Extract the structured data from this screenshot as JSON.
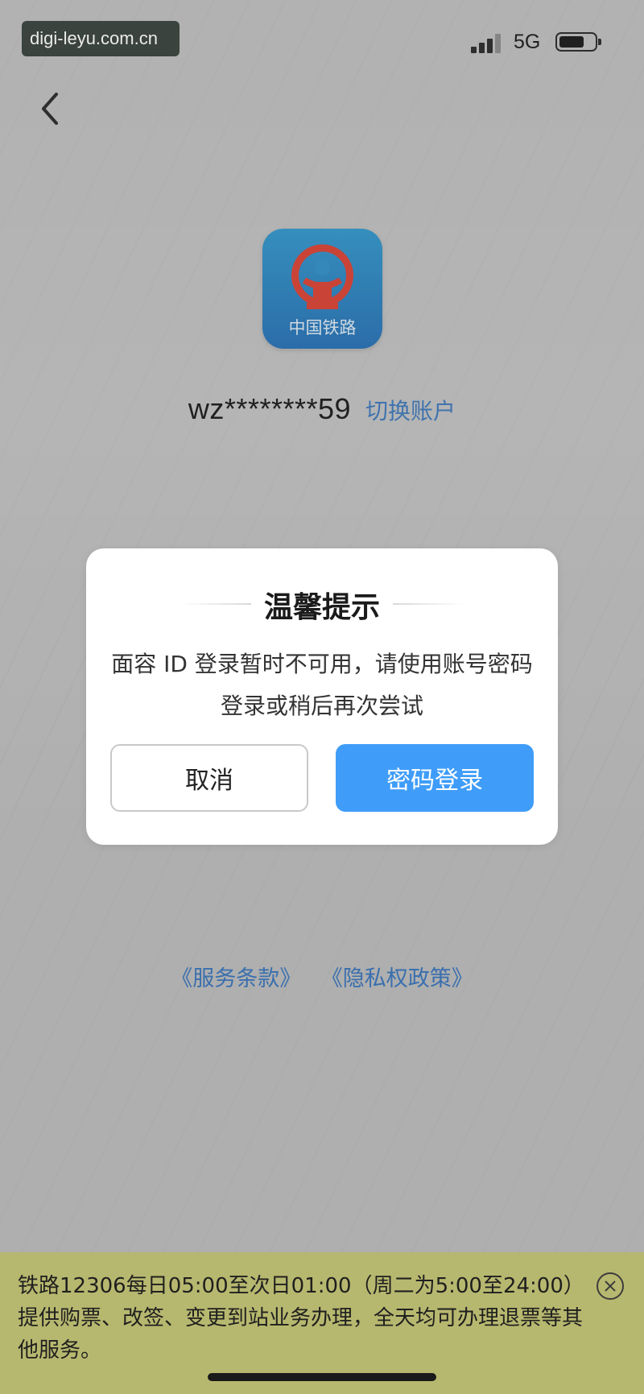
{
  "status_bar": {
    "watermark": "digi-leyu.com.cn",
    "network": "5G"
  },
  "app": {
    "icon_label": "中国铁路",
    "account_masked": "wz********59",
    "switch_account": "切换账户"
  },
  "dialog": {
    "title": "温馨提示",
    "message": "面容 ID 登录暂时不可用，请使用账号密码登录或稍后再次尝试",
    "cancel_label": "取消",
    "confirm_label": "密码登录"
  },
  "links": {
    "terms": "《服务条款》",
    "privacy": "《隐私权政策》"
  },
  "notice": {
    "text": "铁路12306每日05:00至次日01:00（周二为5:00至24:00）提供购票、改签、变更到站业务办理，全天均可办理退票等其他服务。"
  },
  "colors": {
    "accent": "#3f9df9",
    "link": "#3a6fae",
    "notice_bg": "#b7b86f"
  }
}
